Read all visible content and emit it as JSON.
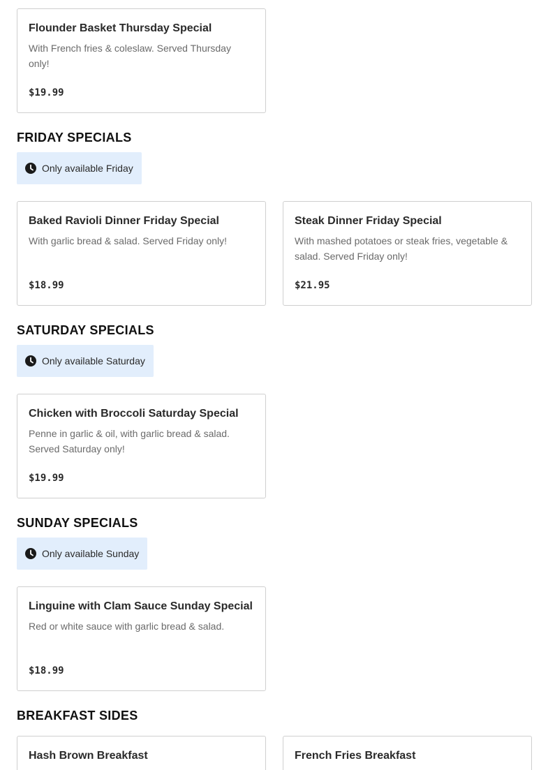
{
  "cards": {
    "flounder": {
      "title": "Flounder Basket Thursday Special",
      "desc": "With French fries & coleslaw. Served Thursday only!",
      "price": "$19.99"
    },
    "ravioli": {
      "title": "Baked Ravioli Dinner Friday Special",
      "desc": "With garlic bread & salad. Served Friday only!",
      "price": "$18.99"
    },
    "steak": {
      "title": "Steak Dinner Friday Special",
      "desc": "With mashed potatoes or steak fries, vegetable & salad. Served Friday only!",
      "price": "$21.95"
    },
    "chicken": {
      "title": "Chicken with Broccoli Saturday Special",
      "desc": "Penne in garlic & oil, with garlic bread & salad. Served Saturday only!",
      "price": "$19.99"
    },
    "linguine": {
      "title": "Linguine with Clam Sauce Sunday Special",
      "desc": "Red or white sauce with garlic bread & salad.",
      "price": "$18.99"
    },
    "hashbrown": {
      "title": "Hash Brown Breakfast"
    },
    "fries": {
      "title": "French Fries Breakfast"
    }
  },
  "sections": {
    "friday": {
      "heading": "FRIDAY SPECIALS",
      "availability": "Only available Friday"
    },
    "saturday": {
      "heading": "SATURDAY SPECIALS",
      "availability": "Only available Saturday"
    },
    "sunday": {
      "heading": "SUNDAY SPECIALS",
      "availability": "Only available Sunday"
    },
    "breakfast_sides": {
      "heading": "BREAKFAST SIDES"
    }
  },
  "icons": {
    "availability": "clock-icon"
  },
  "colors": {
    "badge_bg": "#e2eefc",
    "card_border": "#cfcfcf",
    "desc_text": "#6a6a6a"
  }
}
